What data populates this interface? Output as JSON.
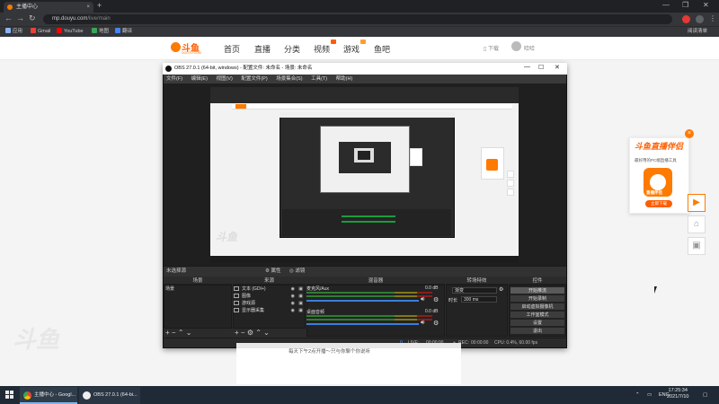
{
  "browser": {
    "tab_title": "主播中心 - Google Chrome",
    "tab_short": "主播中心",
    "url_host": "mp.douyu.com",
    "url_path": "/live/main",
    "bookmarks": [
      "应用",
      "Gmail",
      "YouTube",
      "地图",
      "翻译"
    ],
    "reading_list": "阅读清单",
    "colors": {
      "frame": "#202124",
      "toolbar": "#35363a"
    }
  },
  "site": {
    "logo_text": "斗鱼",
    "logo_sub": "DOUYU.COM",
    "nav": [
      "首页",
      "直播",
      "分类",
      "视频",
      "游戏",
      "鱼吧"
    ],
    "download": "下载",
    "user": "哈哈",
    "brand_color": "#ff5d00",
    "tip_text": "每天下午2点开播～只与你聊个你说听",
    "watermark": "斗鱼"
  },
  "obs": {
    "title": "OBS 27.0.1 (64-bit, windows) - 配置文件: 未命名 - 场景: 未命名",
    "menu": [
      "文件(F)",
      "编辑(E)",
      "视图(V)",
      "配置文件(P)",
      "场景集合(S)",
      "工具(T)",
      "帮助(H)"
    ],
    "source_status": "未选择源",
    "props_button": "属性",
    "filters_button": "滤镜",
    "docks": {
      "scenes": "场景",
      "sources": "来源",
      "mixer": "混音器",
      "transitions": "转场特效",
      "controls": "控件"
    },
    "scenes": [
      "场景"
    ],
    "sources": [
      {
        "name": "文本 (GDI+)",
        "icon": "text-icon"
      },
      {
        "name": "图像",
        "icon": "image-icon"
      },
      {
        "name": "游戏源",
        "icon": "game-icon"
      },
      {
        "name": "显示器采集",
        "icon": "monitor-icon"
      }
    ],
    "mixer": [
      {
        "name": "桌面音频",
        "db": "0.0 dB"
      },
      {
        "name": "麦克风/Aux",
        "db": "0.0 dB"
      }
    ],
    "transition": {
      "value": "渐变",
      "duration_label": "时长",
      "duration": "300 ms"
    },
    "controls": [
      "开始推流",
      "开始录制",
      "启动虚拟摄像机",
      "工作室模式",
      "设置",
      "退出"
    ],
    "status": {
      "drop": "0",
      "live_label": "LIVE:",
      "live_time": "00:00:00",
      "rec_label": "REC:",
      "rec_time": "00:00:00",
      "cpu": "CPU: 0.4%, 60.00 fps"
    }
  },
  "promo": {
    "title": "斗鱼直播伴侣",
    "subtitle": "最好用的PC端直播工具",
    "app_label": "直播伴侣",
    "button": "立即下载"
  },
  "taskbar": {
    "items": [
      "主播中心 - Googl...",
      "OBS 27.0.1 (64-bi..."
    ],
    "lang": "ENG",
    "time": "17:25:34",
    "date": "2021/7/10"
  }
}
